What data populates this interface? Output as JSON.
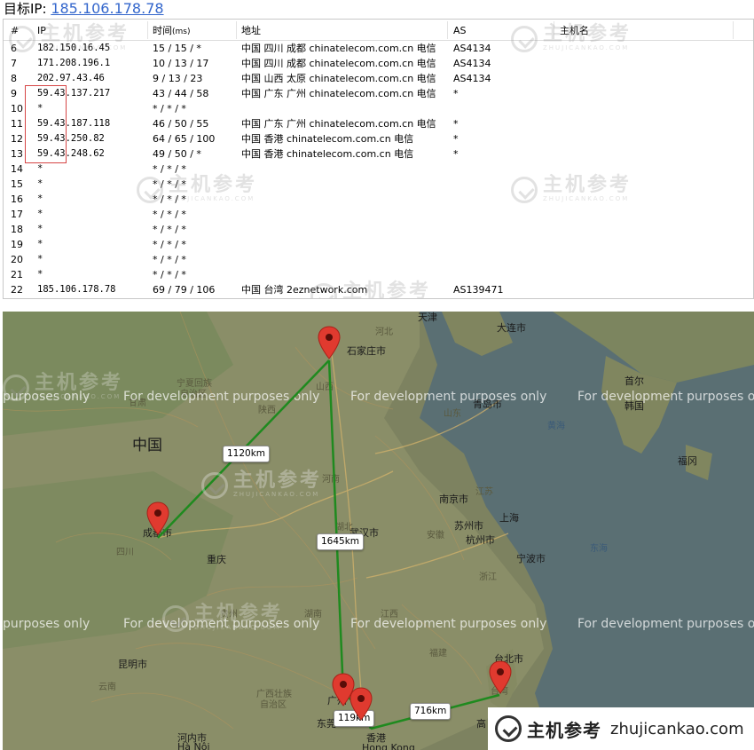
{
  "header": {
    "label": "目标IP:",
    "target_ip": "185.106.178.78"
  },
  "table": {
    "columns": [
      "#",
      "IP",
      "时间",
      "(ms)",
      "地址",
      "AS",
      "主机名"
    ],
    "rows": [
      {
        "num": "6",
        "ip": "182.150.16.45",
        "time": "15 / 15 / *",
        "loc": "中国 四川 成都 chinatelecom.com.cn 电信",
        "as": "AS4134"
      },
      {
        "num": "7",
        "ip": "171.208.196.1",
        "time": "10 / 13 / 17",
        "loc": "中国 四川 成都 chinatelecom.com.cn 电信",
        "as": "AS4134"
      },
      {
        "num": "8",
        "ip": "202.97.43.46",
        "time": "9 / 13 / 23",
        "loc": "中国 山西 太原 chinatelecom.com.cn 电信",
        "as": "AS4134"
      },
      {
        "num": "9",
        "ip": "59.43.137.217",
        "time": "43 / 44 / 58",
        "loc": "中国 广东 广州 chinatelecom.com.cn 电信",
        "as": "*"
      },
      {
        "num": "10",
        "ip": "*",
        "time": "* / * / *",
        "loc": "",
        "as": ""
      },
      {
        "num": "11",
        "ip": "59.43.187.118",
        "time": "46 / 50 / 55",
        "loc": "中国 广东 广州 chinatelecom.com.cn 电信",
        "as": "*"
      },
      {
        "num": "12",
        "ip": "59.43.250.82",
        "time": "64 / 65 / 100",
        "loc": "中国 香港 chinatelecom.com.cn 电信",
        "as": "*"
      },
      {
        "num": "13",
        "ip": "59.43.248.62",
        "time": "49 / 50 / *",
        "loc": "中国 香港 chinatelecom.com.cn 电信",
        "as": "*"
      },
      {
        "num": "14",
        "ip": "*",
        "time": "* / * / *",
        "loc": "",
        "as": ""
      },
      {
        "num": "15",
        "ip": "*",
        "time": "* / * / *",
        "loc": "",
        "as": ""
      },
      {
        "num": "16",
        "ip": "*",
        "time": "* / * / *",
        "loc": "",
        "as": ""
      },
      {
        "num": "17",
        "ip": "*",
        "time": "* / * / *",
        "loc": "",
        "as": ""
      },
      {
        "num": "18",
        "ip": "*",
        "time": "* / * / *",
        "loc": "",
        "as": ""
      },
      {
        "num": "19",
        "ip": "*",
        "time": "* / * / *",
        "loc": "",
        "as": ""
      },
      {
        "num": "20",
        "ip": "*",
        "time": "* / * / *",
        "loc": "",
        "as": ""
      },
      {
        "num": "21",
        "ip": "*",
        "time": "* / * / *",
        "loc": "",
        "as": ""
      },
      {
        "num": "22",
        "ip": "185.106.178.78",
        "time": "69 / 79 / 106",
        "loc": "中国 台湾 2eznetwork.com",
        "as": "AS139471"
      }
    ]
  },
  "watermark": {
    "cn": "主机参考",
    "en": "ZHUJICANKAO.COM"
  },
  "map": {
    "dev_text": "For development purposes only",
    "dev_text_cut_left": "purposes only",
    "dev_text_cut_right": "For development purposes on",
    "country_label": "中国",
    "distances": [
      "1120km",
      "1645km",
      "119km",
      "716km"
    ],
    "places": {
      "tianjin": "天津",
      "hebei": "河北",
      "shijiazhuang": "石家庄市",
      "dalian": "大连市",
      "pyongyang_area": "首尔",
      "korea": "韩国",
      "ningxia": "宁夏回族",
      "ningxia2": "自治区",
      "shaanxi": "陕西",
      "shanxi": "山西",
      "shandong": "山东",
      "qingdao": "青岛市",
      "huanghai": "黄海",
      "henan": "河南",
      "chengdu": "成都市",
      "sichuan": "四川",
      "chongqing": "重庆",
      "hubei": "湖北",
      "wuhan": "武汉市",
      "anhui": "安徽",
      "jiangsu": "江苏",
      "nanjing": "南京市",
      "suzhou": "苏州市",
      "shanghai": "上海",
      "hangzhou": "杭州市",
      "ningbo": "宁波市",
      "zhejiang": "浙江",
      "donghai": "东海",
      "fukuoka": "福冈",
      "guizhou": "贵州",
      "hunan": "湖南",
      "jiangxi": "江西",
      "fujian": "福建",
      "kunming": "昆明市",
      "yunnan": "云南",
      "guangxi": "广西壮族",
      "guangxi2": "自治区",
      "guangzhou": "广州",
      "dongguan": "东莞",
      "hongkong": "香港",
      "hongkong_en": "Hong Kong",
      "taipei": "台北市",
      "taiwan": "台湾",
      "gaoxiong": "高",
      "hanoi": "河内市",
      "hanoi_en": "Hà Nội",
      "gansu": "甘肃",
      "chengdu_west": "自治州"
    }
  },
  "badge": {
    "name": "主机参考",
    "url": "zhujicankao.com"
  }
}
